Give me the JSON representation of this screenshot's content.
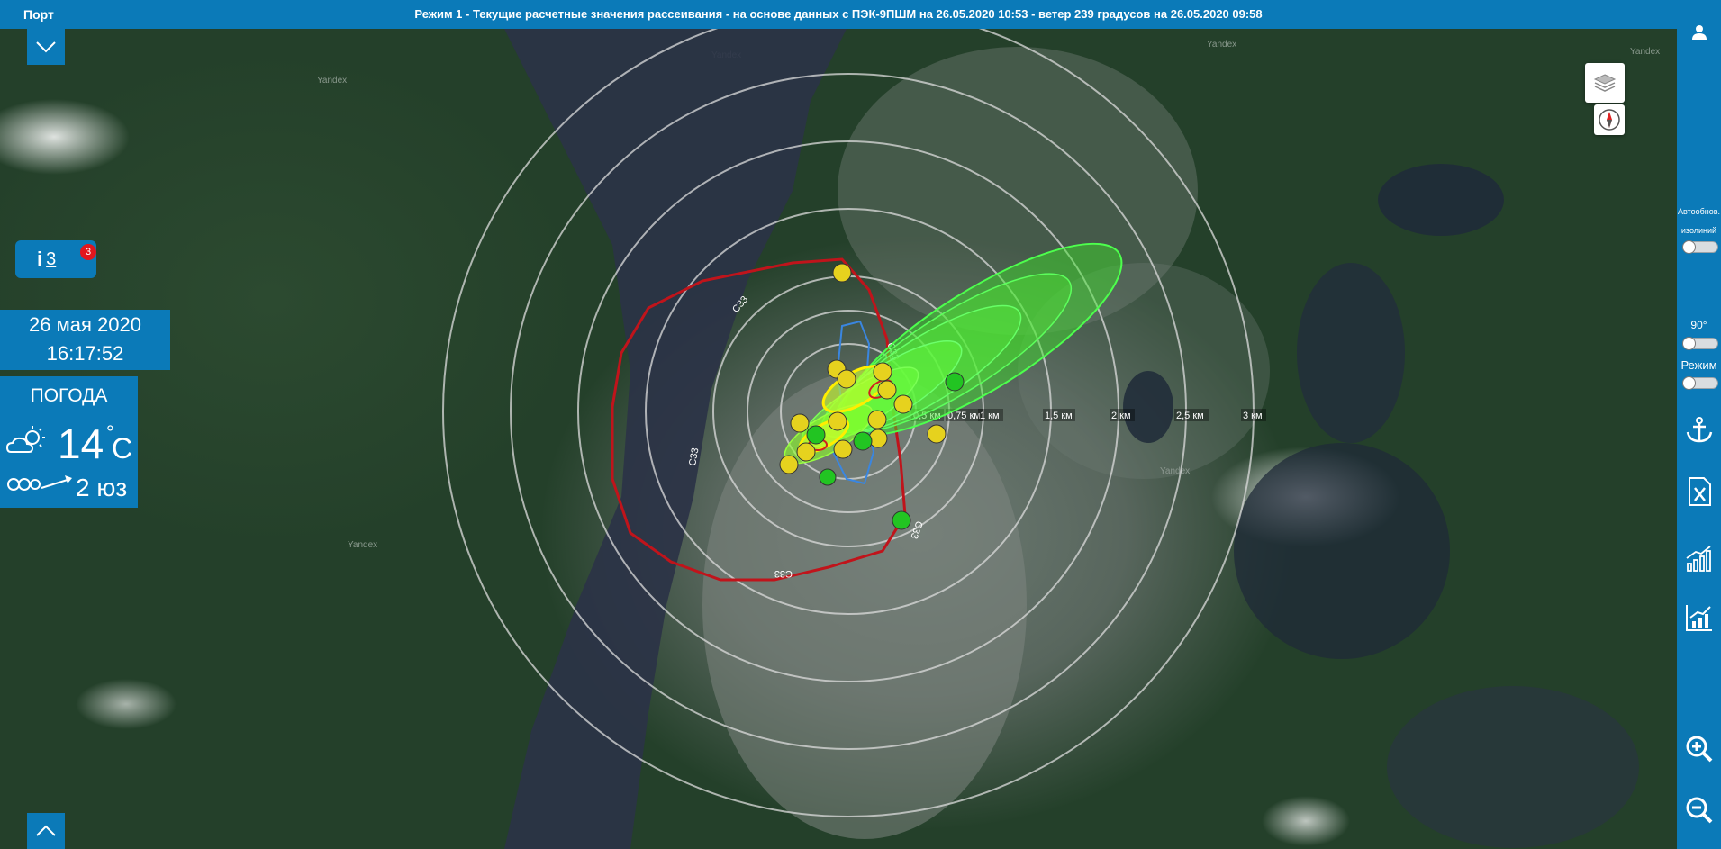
{
  "header": {
    "app_name": "Порт",
    "title": "Режим 1 - Текущие расчетные значения рассеивания - на основе данных с ПЭК-9ПШМ на 26.05.2020 10:53 - ветер 239 градусов на 26.05.2020 09:58"
  },
  "info": {
    "count": "3",
    "badge": "3"
  },
  "datetime": {
    "date": "26 мая 2020",
    "time": "16:17:52"
  },
  "weather": {
    "heading": "ПОГОДА",
    "temperature": "14",
    "degree_symbol": "°",
    "unit": "C",
    "wind": "2 юз",
    "icons": [
      "sun-cloud-icon",
      "wind-icon"
    ]
  },
  "sidebar": {
    "auto_update_label": "Автообнов.",
    "auto_update_label2": "изолиний",
    "angle_label": "90°",
    "mode_label": "Режим",
    "icons": [
      "user-icon",
      "anchor-icon",
      "excel-icon",
      "chart-icon",
      "chart-bars-icon",
      "zoom-in-icon",
      "zoom-out-icon"
    ]
  },
  "map": {
    "watermark": "Yandex",
    "zone_label": "С33",
    "distance_labels": [
      "0,5 км",
      "0,75 км",
      "1 км",
      "1,5 км",
      "2 км",
      "2,5 км",
      "3 км"
    ]
  },
  "colors": {
    "primary": "#0b7ab8",
    "zone_line": "#c0141b",
    "plume_green": "#33ff33",
    "plume_yellow": "#ffee00",
    "marker_yellow": "#e6d21e",
    "marker_green": "#22c422",
    "badge": "#e2161d"
  }
}
